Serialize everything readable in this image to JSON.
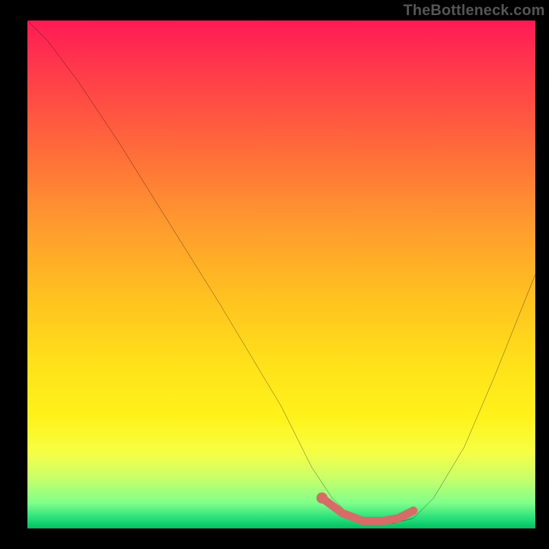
{
  "watermark": "TheBottleneck.com",
  "chart_data": {
    "type": "line",
    "title": "",
    "xlabel": "",
    "ylabel": "",
    "xlim": [
      0,
      100
    ],
    "ylim": [
      0,
      100
    ],
    "grid": false,
    "background_gradient": {
      "stops": [
        {
          "pct": 0,
          "color": "#ff1a55"
        },
        {
          "pct": 10,
          "color": "#ff3b4a"
        },
        {
          "pct": 25,
          "color": "#ff6a3a"
        },
        {
          "pct": 40,
          "color": "#ff9a2e"
        },
        {
          "pct": 55,
          "color": "#ffc31f"
        },
        {
          "pct": 68,
          "color": "#ffe21a"
        },
        {
          "pct": 78,
          "color": "#fff21a"
        },
        {
          "pct": 85,
          "color": "#f6ff44"
        },
        {
          "pct": 90,
          "color": "#c9ff6a"
        },
        {
          "pct": 95,
          "color": "#7fff8a"
        },
        {
          "pct": 98,
          "color": "#26e07a"
        },
        {
          "pct": 100,
          "color": "#00c060"
        }
      ]
    },
    "series": [
      {
        "name": "bottleneck-curve",
        "color": "#000000",
        "x": [
          0,
          4,
          10,
          18,
          28,
          38,
          50,
          56,
          60,
          64,
          68,
          72,
          76,
          80,
          86,
          92,
          100
        ],
        "y": [
          100,
          96,
          88,
          76,
          60,
          44,
          24,
          12,
          6,
          2,
          1,
          1,
          2,
          6,
          16,
          30,
          50
        ]
      }
    ],
    "highlight": {
      "color": "#d86a68",
      "points": [
        {
          "x": 58,
          "y": 6
        },
        {
          "x": 62,
          "y": 3
        },
        {
          "x": 66,
          "y": 1.5
        },
        {
          "x": 70,
          "y": 1.5
        },
        {
          "x": 73,
          "y": 2
        },
        {
          "x": 76,
          "y": 3.5
        }
      ]
    }
  }
}
